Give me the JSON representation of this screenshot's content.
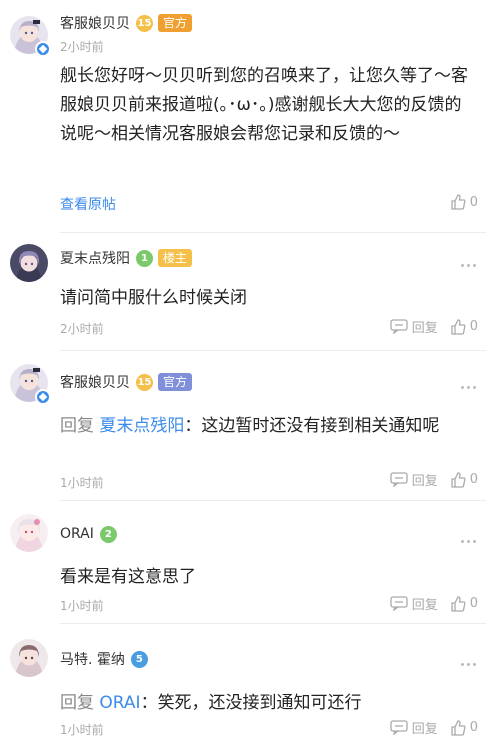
{
  "comments": [
    {
      "username": "客服娘贝贝",
      "level": "15",
      "level_color": "#f5c04a",
      "tag": "官方",
      "tag_color": "#f0a030",
      "time": "2小时前",
      "body": "舰长您好呀～贝贝听到您的召唤来了，让您久等了～客服娘贝贝前来报道啦(｡･ω･｡)感谢舰长大大您的反馈的说呢～相关情况客服娘会帮您记录和反馈的～",
      "link": "查看原帖",
      "like_count": "0"
    },
    {
      "username": "夏末点残阳",
      "level": "1",
      "level_color": "#7cc96b",
      "tag": "楼主",
      "tag_color": "#f5c04a",
      "body": "请问简中服什么时候关闭",
      "time": "2小时前",
      "reply_label": "回复",
      "like_count": "0"
    },
    {
      "username": "客服娘贝贝",
      "level": "15",
      "level_color": "#f5c04a",
      "tag": "官方",
      "tag_color": "#7f8fd8",
      "reply_prefix": "回复",
      "reply_to": "夏末点残阳",
      "reply_text": "这边暂时还没有接到相关通知呢",
      "time": "1小时前",
      "reply_label": "回复",
      "like_count": "0"
    },
    {
      "username": "ORAI",
      "level": "2",
      "level_color": "#7cc96b",
      "body": "看来是有这意思了",
      "time": "1小时前",
      "reply_label": "回复",
      "like_count": "0"
    },
    {
      "username": "马特. 霍纳",
      "level": "5",
      "level_color": "#4a9de0",
      "reply_prefix": "回复",
      "reply_to": "ORAI",
      "reply_text": "笑死，还没接到通知可还行",
      "time": "1小时前",
      "reply_label": "回复",
      "like_count": "0"
    }
  ]
}
